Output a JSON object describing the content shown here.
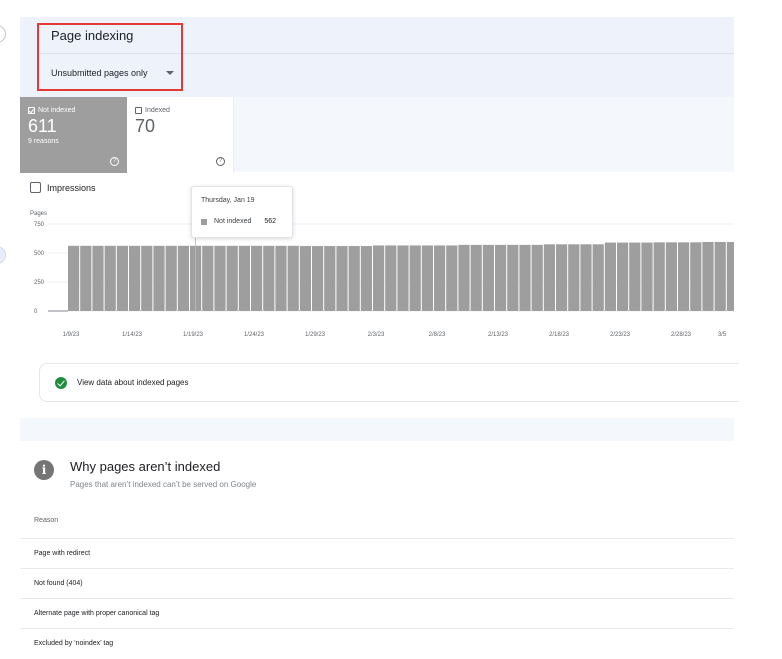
{
  "header": {
    "title": "Page indexing",
    "filter_label": "Unsubmitted pages only",
    "highlight_color": "#e53935"
  },
  "summary": {
    "not_indexed": {
      "label": "Not indexed",
      "value": "611",
      "sub": "9 reasons",
      "color": "#9e9e9e",
      "selected": true
    },
    "indexed": {
      "label": "Indexed",
      "value": "70",
      "selected": false
    }
  },
  "impressions_label": "Impressions",
  "chart_data": {
    "type": "bar",
    "ylabel": "Pages",
    "ylim": [
      0,
      750
    ],
    "yticks": [
      "750",
      "500",
      "250",
      "0"
    ],
    "xtick_labels": [
      "1/9/23",
      "1/14/23",
      "1/19/23",
      "1/24/23",
      "1/29/23",
      "2/3/23",
      "2/8/23",
      "2/13/23",
      "2/18/23",
      "2/23/23",
      "2/28/23",
      "3/5"
    ],
    "series": [
      {
        "values": [
          562,
          562,
          562,
          562,
          562,
          562,
          562,
          562,
          562,
          562,
          562,
          562,
          562,
          562,
          562,
          562,
          562,
          562,
          562,
          560,
          560,
          560,
          560,
          560,
          560,
          565,
          565,
          565,
          565,
          565,
          565,
          565,
          570,
          570,
          570,
          570,
          570,
          570,
          570,
          575,
          575,
          575,
          575,
          575,
          590,
          590,
          590,
          590,
          592,
          592,
          592,
          592,
          595,
          595,
          595,
          595,
          595,
          595
        ]
      }
    ],
    "bar_color": "#9e9e9e"
  },
  "tooltip": {
    "date": "Thursday, Jan 19",
    "series": "Not indexed",
    "value": "562"
  },
  "view_data_label": "View data about indexed pages",
  "why": {
    "title": "Why pages aren’t indexed",
    "subtitle": "Pages that aren’t indexed can’t be served on Google",
    "column_header": "Reason",
    "rows": [
      "Page with redirect",
      "Not found (404)",
      "Alternate page with proper canonical tag",
      "Excluded by ‘noindex’ tag"
    ]
  }
}
